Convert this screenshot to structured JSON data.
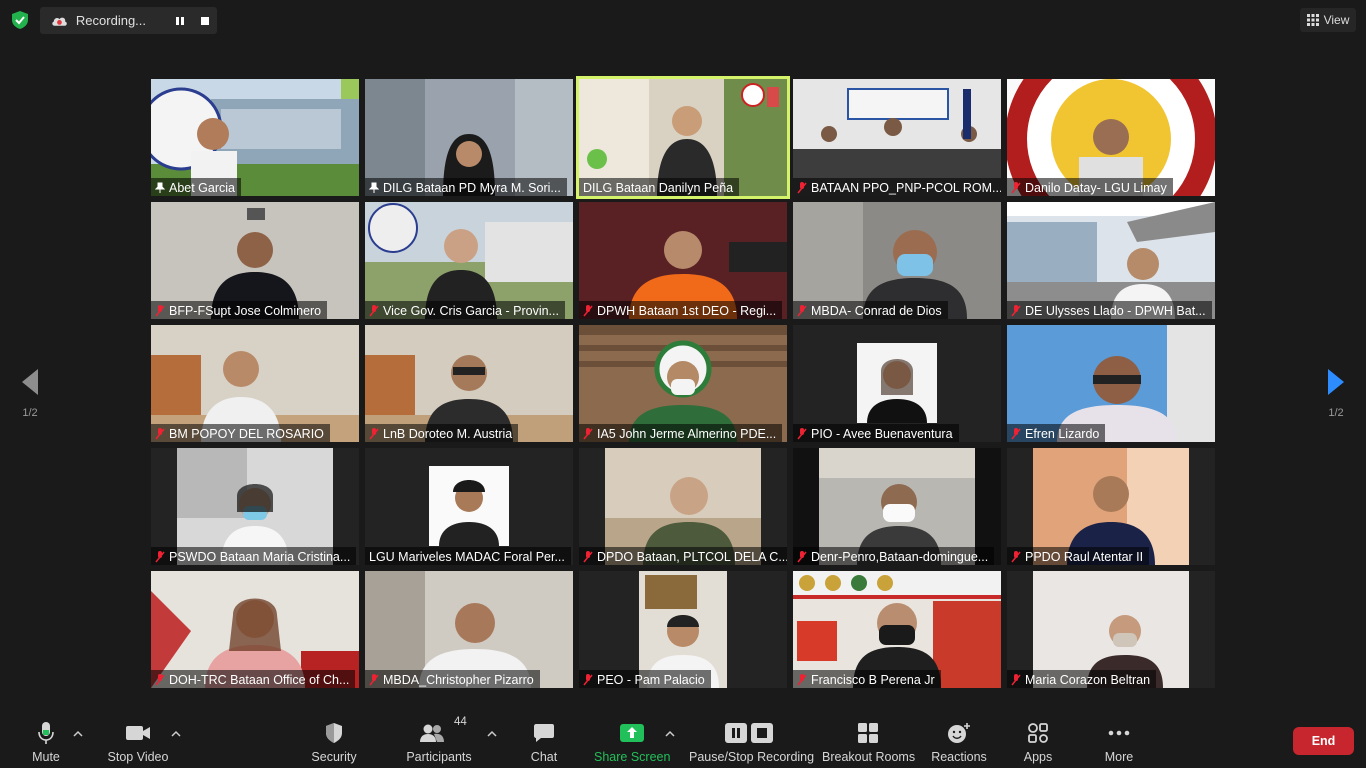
{
  "recording": {
    "label": "Recording..."
  },
  "view_label": "View",
  "pager": {
    "left": "1/2",
    "right": "1/2"
  },
  "participants": [
    "Abet Garcia",
    "DILG Bataan PD Myra M. Sori...",
    "DILG Bataan Danilyn Peña",
    "BATAAN PPO_PNP-PCOL ROM...",
    "Danilo Datay- LGU Limay",
    "BFP-FSupt Jose Colminero",
    "Vice Gov. Cris Garcia - Provin...",
    "DPWH Bataan 1st DEO - Regi...",
    "MBDA- Conrad de Dios",
    "DE Ulysses Llado - DPWH Bat...",
    "BM POPOY DEL ROSARIO",
    "LnB  Doroteo M. Austria",
    "IA5 John Jerme Almerino PDE...",
    "PIO - Avee Buenaventura",
    "Efren Lizardo",
    "PSWDO Bataan Maria Cristina...",
    "LGU Mariveles MADAC Foral Per...",
    "DPDO Bataan, PLTCOL DELA C...",
    "Denr-Penro,Bataan-domingue...",
    "PPDO Raul Atentar II",
    "DOH-TRC Bataan Office of Ch...",
    "MBDA_Christopher Pizarro",
    "PEO - Pam Palacio",
    "Francisco B Perena Jr",
    "Maria Corazon Beltran"
  ],
  "toolbar": {
    "mute": "Mute",
    "stop_video": "Stop Video",
    "security": "Security",
    "participants": "Participants",
    "participants_count": "44",
    "chat": "Chat",
    "share_screen": "Share Screen",
    "pause_stop_recording": "Pause/Stop Recording",
    "breakout_rooms": "Breakout Rooms",
    "reactions": "Reactions",
    "apps": "Apps",
    "more": "More",
    "end": "End"
  },
  "colors": {
    "active_speaker": "#d4f36a",
    "share_green": "#21c05a",
    "end_red": "#c7262e",
    "nav_blue": "#2d8cff"
  }
}
